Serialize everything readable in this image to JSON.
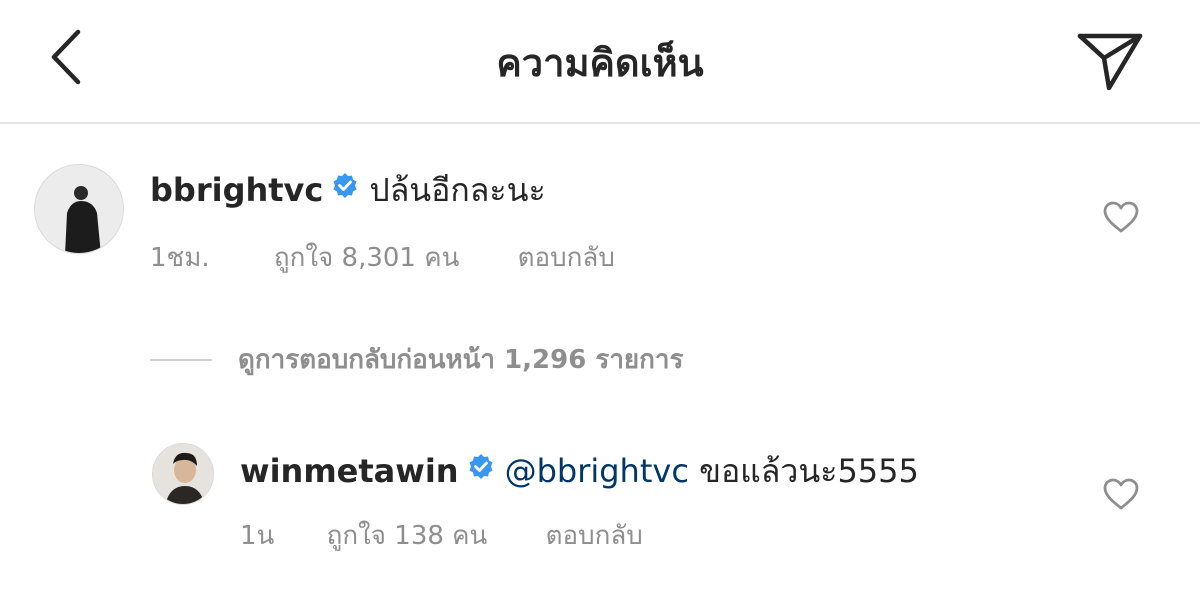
{
  "header": {
    "title": "ความคิดเห็น",
    "back_icon": "chevron-left-icon",
    "share_icon": "send-icon"
  },
  "comments": [
    {
      "username": "bbrightvc",
      "verified": true,
      "text": "ปล้นอีกละนะ",
      "time": "1ชม.",
      "likes": "ถูกใจ 8,301 คน",
      "reply": "ตอบกลับ"
    }
  ],
  "view_replies": {
    "label": "ดูการตอบกลับก่อนหน้า 1,296 รายการ"
  },
  "replies": [
    {
      "username": "winmetawin",
      "verified": true,
      "mention": "@bbrightvc",
      "text": "ขอแล้วนะ5555",
      "time": "1น",
      "likes": "ถูกใจ 138 คน",
      "reply": "ตอบกลับ"
    }
  ],
  "colors": {
    "verified_badge": "#3897f0",
    "mention": "#00376b",
    "meta_text": "#8e8e8e",
    "primary_text": "#262626"
  }
}
